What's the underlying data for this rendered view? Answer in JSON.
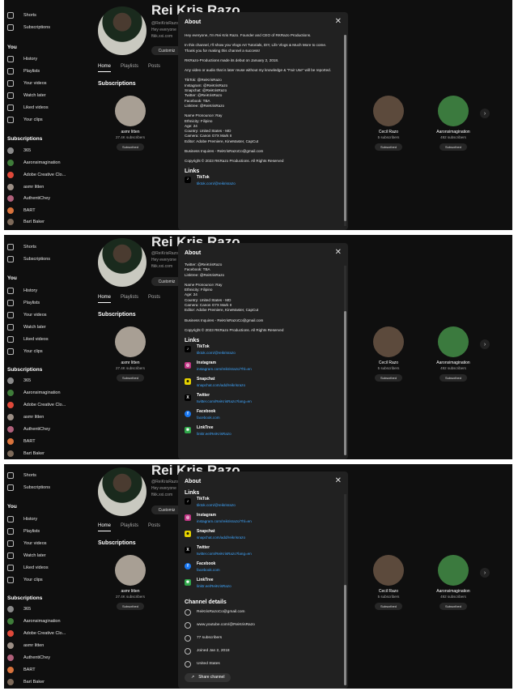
{
  "sidebar": {
    "items": [
      {
        "label": "Shorts"
      },
      {
        "label": "Subscriptions"
      }
    ],
    "you_heading": "You",
    "you_items": [
      {
        "label": "History"
      },
      {
        "label": "Playlists"
      },
      {
        "label": "Your videos"
      },
      {
        "label": "Watch later"
      },
      {
        "label": "Liked videos"
      },
      {
        "label": "Your clips"
      }
    ],
    "subs_heading": "Subscriptions",
    "subs": [
      {
        "label": "365",
        "color": "#8a8a8a"
      },
      {
        "label": "Aaronsimagination",
        "color": "#3f7d3a"
      },
      {
        "label": "Adobe Creative Clo...",
        "color": "#e0493a"
      },
      {
        "label": "asmr litten",
        "color": "#9c8f86"
      },
      {
        "label": "AuthentiChey",
        "color": "#b0607a"
      },
      {
        "label": "BART",
        "color": "#d9733c"
      },
      {
        "label": "Bart Baker",
        "color": "#7d6a5a"
      }
    ]
  },
  "channel": {
    "name": "Rei Kris Razo",
    "handle": "@ReiKrisRazo",
    "meta1": "Hey everyone",
    "meta2": "ftkk.xxi.com",
    "customize": "Customiz",
    "tabs": [
      "Home",
      "Playlists",
      "Posts"
    ],
    "subs_title": "Subscriptions"
  },
  "sub_cards": [
    {
      "name": "asmr litten",
      "count": "27.4K subscribers",
      "btn": "Subscribed",
      "color": "#a89f94"
    },
    {
      "name": "Cecil Razo",
      "count": "5 subscribers",
      "btn": "Subscribed",
      "color": "#5c4a3c"
    },
    {
      "name": "Aaronsimagination",
      "count": "492 subscribers",
      "btn": "Subscribed",
      "color": "#3b7a3e"
    }
  ],
  "modal": {
    "title": "About",
    "close": "✕",
    "description": [
      "Hey everyone, I'm Rei Kris Razo. Founder and CEO of RKRazo Productions.",
      "In this channel, I'll show you Vlogs Art Tutorials, DIY, Life Vlogs & Much More to come.",
      "Thank you for making this channel a success!",
      "RKRazo-Productions made its debut on January 2, 2018.",
      "Any video or audio that is later reuse without my knowledge & \"Fair Use\" will be reported.",
      "TikTok: @ReiKrisRazo\nInstagram: @ReiKrisRazo\nSnapchat: @ReiKrisRazo\nTwitter: @ReiKrisRazo\nFacebook: TBA\nLinktree: @ReiKrisRazo",
      "Name Pronounce: Ray\nEthnicity: Filipino\nAge: 24\nCountry: United States - MD\nCamera: Canon G7X Mark II\nEditor: Adobe Premiere, KineMaster, CapCut",
      "Business Inquires - ReiKrisRazoCo@gmail.com",
      "Copyright © 2023 RKRazo Productions. All Rights Reserved"
    ],
    "partial_desc": [
      "Twitter: @ReiKrisRazo\nFacebook: TBA\nLinktree: @ReiKrisRazo",
      "Name Pronounce: Ray\nEthnicity: Filipino\nAge: 24\nCountry: United States - MD\nCamera: Canon G7X Mark II\nEditor: Adobe Premiere, KineMaster, CapCut",
      "Business Inquires - ReiKrisRazoCo@gmail.com",
      "Copyright © 2023 RKRazo Productions. All Rights Reserved"
    ],
    "links_title": "Links",
    "links": [
      {
        "title": "TikTok",
        "url": "tiktok.com/@reikrisrazo",
        "icon": "tiktok-icon",
        "glyph": "♪",
        "color": "#000000"
      },
      {
        "title": "Instagram",
        "url": "instagram.com/reikrisrazo/?hl=en",
        "icon": "instagram-icon",
        "glyph": "◎",
        "color": "#c13584"
      },
      {
        "title": "Snapchat",
        "url": "snapchat.com/add/reikrisrazo",
        "icon": "snapchat-icon",
        "glyph": "☻",
        "color": "#e6d200"
      },
      {
        "title": "Twitter",
        "url": "twitter.com/ReiKrisRazo?lang=en",
        "icon": "twitter-icon",
        "glyph": "X",
        "color": "#000000"
      },
      {
        "title": "Facebook",
        "url": "facebook.com",
        "icon": "facebook-icon",
        "glyph": "f",
        "color": "#1877f2"
      },
      {
        "title": "LinkTree",
        "url": "linktr.ee/ReiKrisRazo",
        "icon": "linktree-icon",
        "glyph": "✱",
        "color": "#30a74a"
      }
    ],
    "details_title": "Channel details",
    "details": [
      {
        "text": "ReiKrisRazoCo@gmail.com",
        "icon": "mail-icon"
      },
      {
        "text": "www.youtube.com/@ReiKrisRazo",
        "icon": "globe-icon"
      },
      {
        "text": "77 subscribers",
        "icon": "subscribers-icon"
      },
      {
        "text": "Joined Jan 2, 2018",
        "icon": "info-icon"
      },
      {
        "text": "United States",
        "icon": "location-icon"
      }
    ],
    "share": "Share channel"
  }
}
